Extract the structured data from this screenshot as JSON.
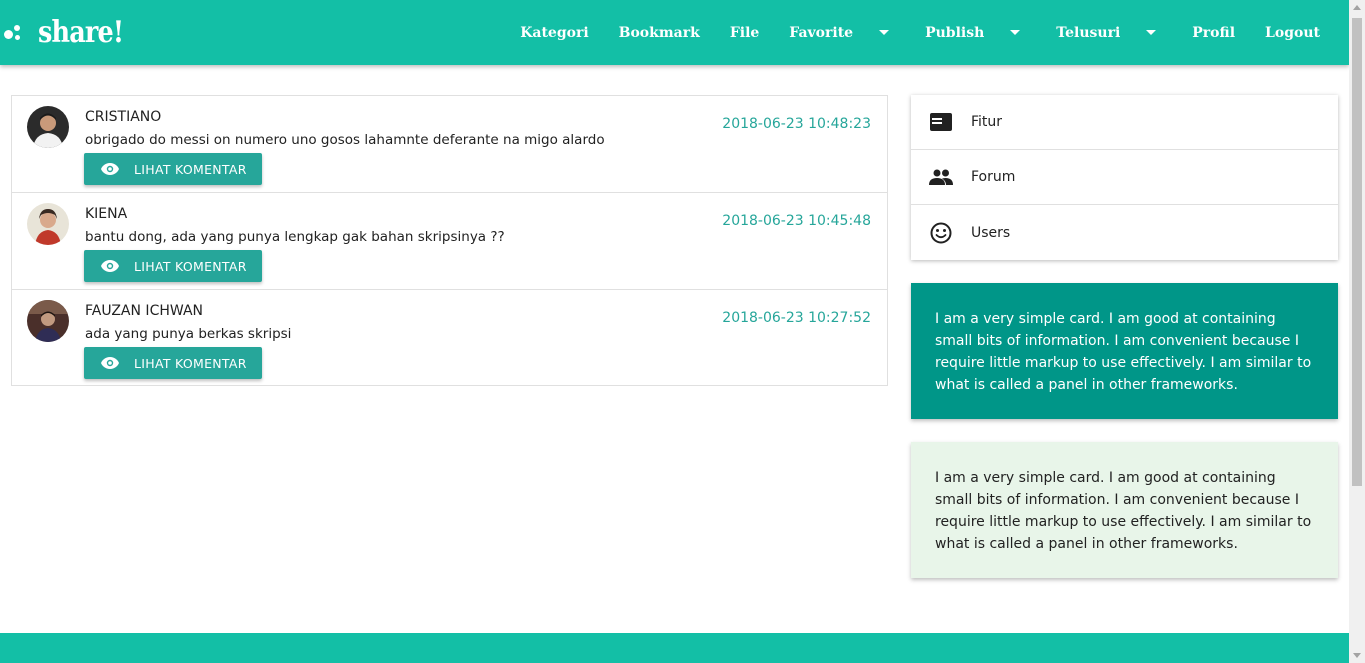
{
  "brand": {
    "name": "share!"
  },
  "nav": {
    "items": [
      {
        "label": "Kategori",
        "dropdown": false
      },
      {
        "label": "Bookmark",
        "dropdown": false
      },
      {
        "label": "File",
        "dropdown": false
      },
      {
        "label": "Favorite",
        "dropdown": true
      },
      {
        "label": "Publish",
        "dropdown": true
      },
      {
        "label": "Telusuri",
        "dropdown": true
      },
      {
        "label": "Profil",
        "dropdown": false
      },
      {
        "label": "Logout",
        "dropdown": false
      }
    ]
  },
  "posts": [
    {
      "name": "CRISTIANO",
      "text": "obrigado do messi on numero uno gosos lahamnte deferante na migo alardo",
      "time": "2018-06-23 10:48:23",
      "button": "LIHAT KOMENTAR"
    },
    {
      "name": "KIENA",
      "text": "bantu dong, ada yang punya lengkap gak bahan skripsinya ??",
      "time": "2018-06-23 10:45:48",
      "button": "LIHAT KOMENTAR"
    },
    {
      "name": "FAUZAN ICHWAN",
      "text": "ada yang punya berkas skripsi",
      "time": "2018-06-23 10:27:52",
      "button": "LIHAT KOMENTAR"
    }
  ],
  "side_menu": {
    "items": [
      {
        "label": "Fitur",
        "icon": "web-icon"
      },
      {
        "label": "Forum",
        "icon": "people-icon"
      },
      {
        "label": "Users",
        "icon": "smiley-icon"
      }
    ]
  },
  "cards": {
    "teal": {
      "text": "I am a very simple card. I am good at containing small bits of information. I am convenient because I require little markup to use effectively. I am similar to what is called a panel in other frameworks."
    },
    "light": {
      "text": "I am a very simple card. I am good at containing small bits of information. I am convenient because I require little markup to use effectively. I am similar to what is called a panel in other frameworks."
    }
  },
  "colors": {
    "primary": "#13bfa6",
    "button": "#26a69a",
    "card_teal": "#009688",
    "card_light": "#e8f5e9",
    "timestamp": "#26a69a"
  }
}
